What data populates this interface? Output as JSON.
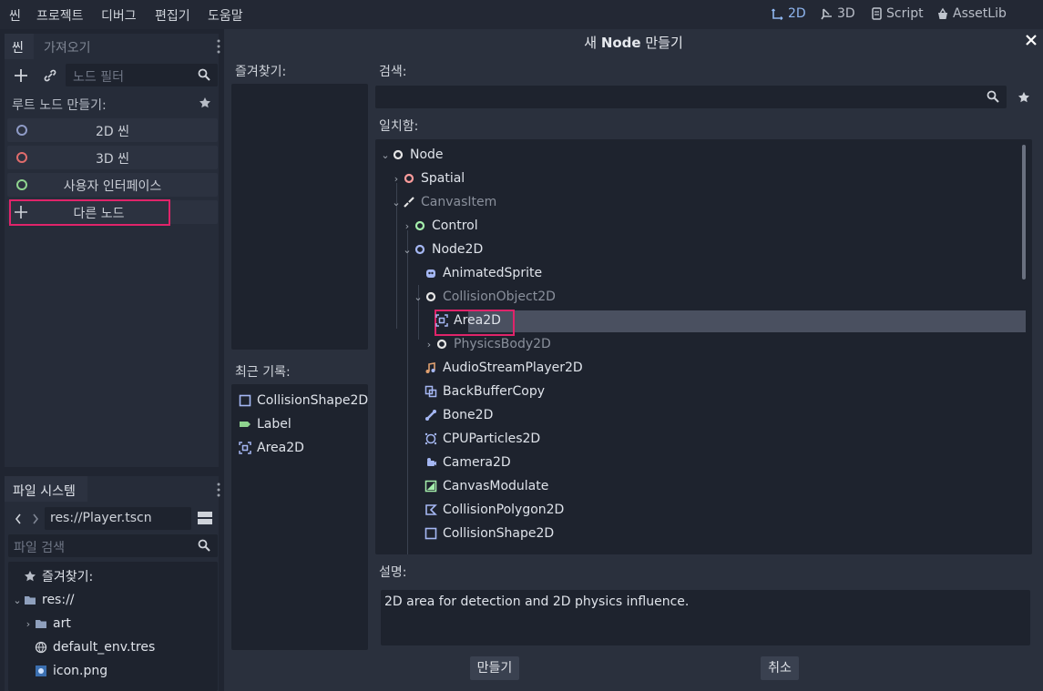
{
  "menubar": {
    "items": [
      "씬",
      "프로젝트",
      "디버그",
      "편집기",
      "도움말"
    ],
    "workspaces": [
      {
        "label": "2D",
        "icon": "2d-icon",
        "active": true
      },
      {
        "label": "3D",
        "icon": "3d-icon",
        "active": false
      },
      {
        "label": "Script",
        "icon": "script-icon",
        "active": false
      },
      {
        "label": "AssetLib",
        "icon": "assetlib-icon",
        "active": false
      }
    ]
  },
  "scene_dock": {
    "tabs": [
      "씬",
      "가져오기"
    ],
    "filter_placeholder": "노드 필터",
    "root_label": "루트 노드 만들기:",
    "buttons": [
      {
        "label": "2D 씬",
        "color": "#8f9bc6"
      },
      {
        "label": "3D 씬",
        "color": "#e06c6c"
      },
      {
        "label": "사용자 인터페이스",
        "color": "#8fd48f"
      },
      {
        "label": "다른 노드"
      }
    ]
  },
  "filesystem_dock": {
    "tab": "파일 시스템",
    "path": "res://Player.tscn",
    "search_placeholder": "파일 검색",
    "items": [
      {
        "label": "즐겨찾기:",
        "icon": "star-icon"
      },
      {
        "label": "res://",
        "icon": "folder-icon"
      },
      {
        "label": "art",
        "icon": "folder-icon"
      },
      {
        "label": "default_env.tres",
        "icon": "globe-icon"
      },
      {
        "label": "icon.png",
        "icon": "image-icon"
      }
    ]
  },
  "dialog": {
    "title_prefix": "새 ",
    "title_bold": "Node",
    "title_suffix": " 만들기",
    "favorites_label": "즐겨찾기:",
    "recent_label": "최근 기록:",
    "recent_items": [
      {
        "label": "CollisionShape2D",
        "icon": "collisionshape2d-icon"
      },
      {
        "label": "Label",
        "icon": "label-icon"
      },
      {
        "label": "Area2D",
        "icon": "area2d-icon"
      }
    ],
    "search_label": "검색:",
    "matches_label": "일치함:",
    "tree": [
      {
        "label": "Node",
        "depth": 0,
        "chevron": "open",
        "icon": "node-icon",
        "color": "#e6e6e6",
        "dim": false
      },
      {
        "label": "Spatial",
        "depth": 1,
        "chevron": "closed",
        "icon": "spatial-icon",
        "color": "#fc9c9c",
        "dim": false
      },
      {
        "label": "CanvasItem",
        "depth": 1,
        "chevron": "open",
        "icon": "canvasitem-icon",
        "color": "#e6e6e6",
        "dim": true
      },
      {
        "label": "Control",
        "depth": 2,
        "chevron": "closed",
        "icon": "control-icon",
        "color": "#a5efac",
        "dim": false
      },
      {
        "label": "Node2D",
        "depth": 2,
        "chevron": "open",
        "icon": "node2d-icon",
        "color": "#a5b7f3",
        "dim": false
      },
      {
        "label": "AnimatedSprite",
        "depth": 3,
        "chevron": "none",
        "icon": "animatedsprite-icon",
        "color": "#a5b7f3",
        "dim": false
      },
      {
        "label": "CollisionObject2D",
        "depth": 3,
        "chevron": "open",
        "icon": "collisionobject2d-icon",
        "color": "#e6e6e6",
        "dim": true
      },
      {
        "label": "Area2D",
        "depth": 4,
        "chevron": "none",
        "icon": "area2d-icon",
        "color": "#a5b7f3",
        "dim": false,
        "selected": true
      },
      {
        "label": "PhysicsBody2D",
        "depth": 4,
        "chevron": "closed",
        "icon": "physicsbody2d-icon",
        "color": "#e6e6e6",
        "dim": true
      },
      {
        "label": "AudioStreamPlayer2D",
        "depth": 3,
        "chevron": "none",
        "icon": "audiostreamplayer2d-icon",
        "color": "#e0a070",
        "dim": false
      },
      {
        "label": "BackBufferCopy",
        "depth": 3,
        "chevron": "none",
        "icon": "backbuffercopy-icon",
        "color": "#a5b7f3",
        "dim": false
      },
      {
        "label": "Bone2D",
        "depth": 3,
        "chevron": "none",
        "icon": "bone2d-icon",
        "color": "#a5b7f3",
        "dim": false
      },
      {
        "label": "CPUParticles2D",
        "depth": 3,
        "chevron": "none",
        "icon": "cpuparticles2d-icon",
        "color": "#a5b7f3",
        "dim": false
      },
      {
        "label": "Camera2D",
        "depth": 3,
        "chevron": "none",
        "icon": "camera2d-icon",
        "color": "#a5b7f3",
        "dim": false
      },
      {
        "label": "CanvasModulate",
        "depth": 3,
        "chevron": "none",
        "icon": "canvasmodulate-icon",
        "color": "#a5efac",
        "dim": false
      },
      {
        "label": "CollisionPolygon2D",
        "depth": 3,
        "chevron": "none",
        "icon": "collisionpolygon2d-icon",
        "color": "#a5b7f3",
        "dim": false
      },
      {
        "label": "CollisionShape2D",
        "depth": 3,
        "chevron": "none",
        "icon": "collisionshape2d-icon",
        "color": "#a5b7f3",
        "dim": false
      }
    ],
    "description_label": "설명:",
    "description": "2D area for detection and 2D physics influence.",
    "create_button": "만들기",
    "cancel_button": "취소"
  },
  "colors": {
    "highlight": "#e0246a",
    "selection": "#4a5060",
    "accent": "#8fb6f0"
  }
}
